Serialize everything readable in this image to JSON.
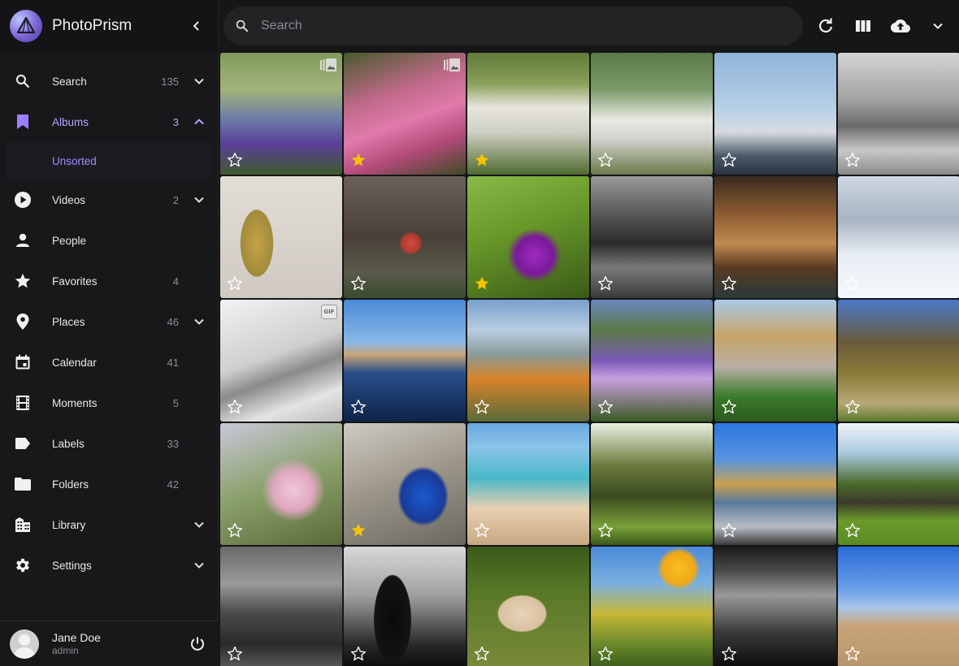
{
  "app": {
    "title": "PhotoPrism"
  },
  "nav": {
    "items": [
      {
        "key": "search",
        "label": "Search",
        "count": "135",
        "expand": "down"
      },
      {
        "key": "albums",
        "label": "Albums",
        "count": "3",
        "expand": "up"
      },
      {
        "key": "videos",
        "label": "Videos",
        "count": "2",
        "expand": "down"
      },
      {
        "key": "people",
        "label": "People",
        "count": "",
        "expand": ""
      },
      {
        "key": "favorites",
        "label": "Favorites",
        "count": "4",
        "expand": ""
      },
      {
        "key": "places",
        "label": "Places",
        "count": "46",
        "expand": "down"
      },
      {
        "key": "calendar",
        "label": "Calendar",
        "count": "41",
        "expand": ""
      },
      {
        "key": "moments",
        "label": "Moments",
        "count": "5",
        "expand": ""
      },
      {
        "key": "labels",
        "label": "Labels",
        "count": "33",
        "expand": ""
      },
      {
        "key": "folders",
        "label": "Folders",
        "count": "42",
        "expand": ""
      },
      {
        "key": "library",
        "label": "Library",
        "count": "",
        "expand": "down"
      },
      {
        "key": "settings",
        "label": "Settings",
        "count": "",
        "expand": "down"
      }
    ],
    "albums_sub": {
      "label": "Unsorted"
    }
  },
  "user": {
    "name": "Jane Doe",
    "role": "admin"
  },
  "search": {
    "placeholder": "Search",
    "value": ""
  },
  "colors": {
    "accent": "#a58bff",
    "favorite": "#f5c400",
    "sidebar": "#18181b",
    "background": "#161618"
  },
  "photos": [
    {
      "name": "crocus-meadow",
      "fav": false,
      "badge": "stack",
      "bg": "linear-gradient(180deg,#7f9a5c 0%,#a4b47a 30%,#6a7aa8 55%,#5a3f9a 75%,#3f5a2a 100%)"
    },
    {
      "name": "pink-azaleas",
      "fav": true,
      "badge": "stack",
      "bg": "linear-gradient(160deg,#4a5a2c 0%,#c06a8a 35%,#e07aaa 55%,#b34a7a 75%,#3e4a22 100%)"
    },
    {
      "name": "white-cottage",
      "fav": true,
      "badge": "",
      "bg": "linear-gradient(180deg,#5f7a3a 0%,#8aa05a 25%,#e8e6dc 45%,#cfcfc4 65%,#4f6b30 100%)"
    },
    {
      "name": "swan-pedal-boats",
      "fav": false,
      "badge": "",
      "bg": "linear-gradient(180deg,#5a7a48 0%,#7a9a68 30%,#e9e9e4 55%,#d4d4cf 70%,#6a7a4a 100%)"
    },
    {
      "name": "harbor-cn-tower",
      "fav": false,
      "badge": "",
      "bg": "linear-gradient(180deg,#8fb4d8 0%,#b6cfe6 45%,#d7dbe0 65%,#4a5868 85%,#2a3440 100%)"
    },
    {
      "name": "bridge-bw",
      "fav": false,
      "badge": "",
      "bg": "linear-gradient(180deg,#d4d4d4 0%,#a0a0a0 40%,#6a6a6a 60%,#c8c8c8 80%,#8a8a8a 100%)"
    },
    {
      "name": "meerkat-painting",
      "fav": false,
      "badge": "",
      "bg": "radial-gradient(ellipse 22% 45% at 30% 55%,#c6a448 0%,#a08a3a 60%,transparent 62%),linear-gradient(180deg,#e2ddd6,#cfc9c1)"
    },
    {
      "name": "wooden-shed-3",
      "fav": false,
      "badge": "",
      "bg": "radial-gradient(circle at 55% 55%,#d04a40 0%,#b03a30 10%,transparent 12%),linear-gradient(180deg,#6a6058 0%,#4a4038 50%,#5a5a4a 80%,#3a4a30 100%)"
    },
    {
      "name": "butterfly-lilac",
      "fav": true,
      "badge": "",
      "bg": "radial-gradient(circle at 55% 65%,#a02ac0 0%,#7a1a9a 18%,transparent 26%),linear-gradient(160deg,#8ab84a 0%,#6a9a2a 40%,#3a5a18 100%)"
    },
    {
      "name": "city-skyline-bw",
      "fav": false,
      "badge": "",
      "bg": "linear-gradient(180deg,#9a9a9a 0%,#5a5a5a 30%,#2a2a2a 55%,#7a7a7a 75%,#3a3a3a 100%)"
    },
    {
      "name": "bakery-counter",
      "fav": false,
      "badge": "",
      "bg": "linear-gradient(180deg,#3a2a1e 0%,#8a5a30 30%,#c08a50 55%,#5a3a22 75%,#2a3a3a 100%)"
    },
    {
      "name": "snowy-forest",
      "fav": false,
      "badge": "",
      "bg": "linear-gradient(180deg,#cfd8e4 0%,#a8b4c2 35%,#e8eef5 65%,#f4f7fb 100%)"
    },
    {
      "name": "newtons-cradle",
      "fav": false,
      "badge": "gif",
      "bg": "linear-gradient(160deg,#f2f2f2 0%,#cfcfcf 45%,#8a8a8a 60%,#e4e4e4 80%,#bcbcbc 100%)"
    },
    {
      "name": "lake-reflection",
      "fav": false,
      "badge": "",
      "bg": "linear-gradient(180deg,#4a8ad8 0%,#8ab8e8 35%,#c8a478 45%,#2a4e8a 60%,#0e2448 100%)"
    },
    {
      "name": "greenhouse",
      "fav": false,
      "badge": "",
      "bg": "linear-gradient(180deg,#7aa0d0 0%,#b8cde0 25%,#8a9a9a 45%,#d8842a 65%,#5a6a3a 100%)"
    },
    {
      "name": "purple-crocuses",
      "fav": false,
      "badge": "",
      "bg": "linear-gradient(180deg,#6a88c0 0%,#5a7a48 25%,#7a5ab8 50%,#c8a0e0 65%,#3a5a22 100%)"
    },
    {
      "name": "modern-building",
      "fav": false,
      "badge": "",
      "bg": "linear-gradient(180deg,#a8c8e8 0%,#c8a468 30%,#b8b0a4 55%,#3a7a2a 80%,#2a5a1e 100%)"
    },
    {
      "name": "pergola-path",
      "fav": false,
      "badge": "",
      "bg": "linear-gradient(180deg,#4a78c8 0%,#6a5a3a 35%,#8a7a38 60%,#b8a878 85%,#5a7a2a 100%)"
    },
    {
      "name": "magnolia-blossoms",
      "fav": false,
      "badge": "",
      "bg": "radial-gradient(circle at 60% 55%,#f0c8d8 0%,#e0a8c0 20%,transparent 32%),linear-gradient(160deg,#c8c8d8 0%,#8aa06a 50%,#5a6a3a 100%)"
    },
    {
      "name": "peacock",
      "fav": true,
      "badge": "",
      "bg": "radial-gradient(ellipse 30% 35% at 65% 60%,#1a5ad0 0%,#1a3a98 60%,transparent 70%),linear-gradient(160deg,#cfcac0 0%,#9a9488 50%,#6a6860 100%)"
    },
    {
      "name": "beach-rocks",
      "fav": false,
      "badge": "",
      "bg": "linear-gradient(180deg,#6aa8e0 0%,#8ac4e8 20%,#4ab8c8 45%,#e8d0b0 70%,#c8a884 100%)"
    },
    {
      "name": "forest-shadows",
      "fav": false,
      "badge": "",
      "bg": "linear-gradient(180deg,#e8f0e0 0%,#6a7a3a 35%,#3a4a1e 60%,#7aa03a 85%,#3a5a1a 100%)"
    },
    {
      "name": "cement-truck-silos",
      "fav": false,
      "badge": "",
      "bg": "linear-gradient(180deg,#2a78e0 0%,#5a94e0 30%,#c8a050 50%,#5a7a98 65%,#b8bcc4 85%,#3a3a3a 100%)"
    },
    {
      "name": "cattle-pasture",
      "fav": false,
      "badge": "",
      "bg": "linear-gradient(180deg,#f0f4f8 0%,#a8c8e0 25%,#4a6a2a 50%,#3a3a2a 65%,#6a9a2a 80%,#5a8a24 100%)"
    },
    {
      "name": "dome-interior",
      "fav": false,
      "badge": "",
      "bg": "linear-gradient(180deg,#6a6a6a 0%,#9a9a9a 30%,#4a4a4a 55%,#2a2a2a 80%,#5a5a5a 100%)"
    },
    {
      "name": "castle-silhouette",
      "fav": false,
      "badge": "",
      "bg": "radial-gradient(ellipse 25% 60% at 40% 60%,#0a0a0a 0%,#141414 60%,transparent 62%),linear-gradient(180deg,#d8d8d8 0%,#a0a0a0 40%,#2a2a2a 80%,#0a0a0a 100%)"
    },
    {
      "name": "cow-grazing",
      "fav": false,
      "badge": "",
      "bg": "radial-gradient(ellipse 32% 24% at 45% 55%,#e8d4b8 0%,#d8c0a0 60%,transparent 64%),linear-gradient(180deg,#3a5a1a 0%,#5a7a28 40%,#7a8a3a 100%)"
    },
    {
      "name": "yellow-poppies",
      "fav": false,
      "badge": "",
      "bg": "radial-gradient(circle at 72% 18%,#f8c020 0%,#f0a818 12%,transparent 16%),linear-gradient(180deg,#4a8ad8 0%,#7ab0e0 30%,#c8b838 55%,#6a8a2a 80%,#3a5a1a 100%)"
    },
    {
      "name": "window-bw",
      "fav": false,
      "badge": "",
      "bg": "linear-gradient(180deg,#1a1a1a 0%,#4a4a4a 20%,#9a9a9a 40%,#3a3a3a 70%,#0a0a0a 100%)"
    },
    {
      "name": "barbed-wire-field",
      "fav": false,
      "badge": "",
      "bg": "linear-gradient(180deg,#2a6ad8 0%,#6aa0e8 35%,#a8c4e8 50%,#c8a478 65%,#b8946a 100%)"
    }
  ]
}
